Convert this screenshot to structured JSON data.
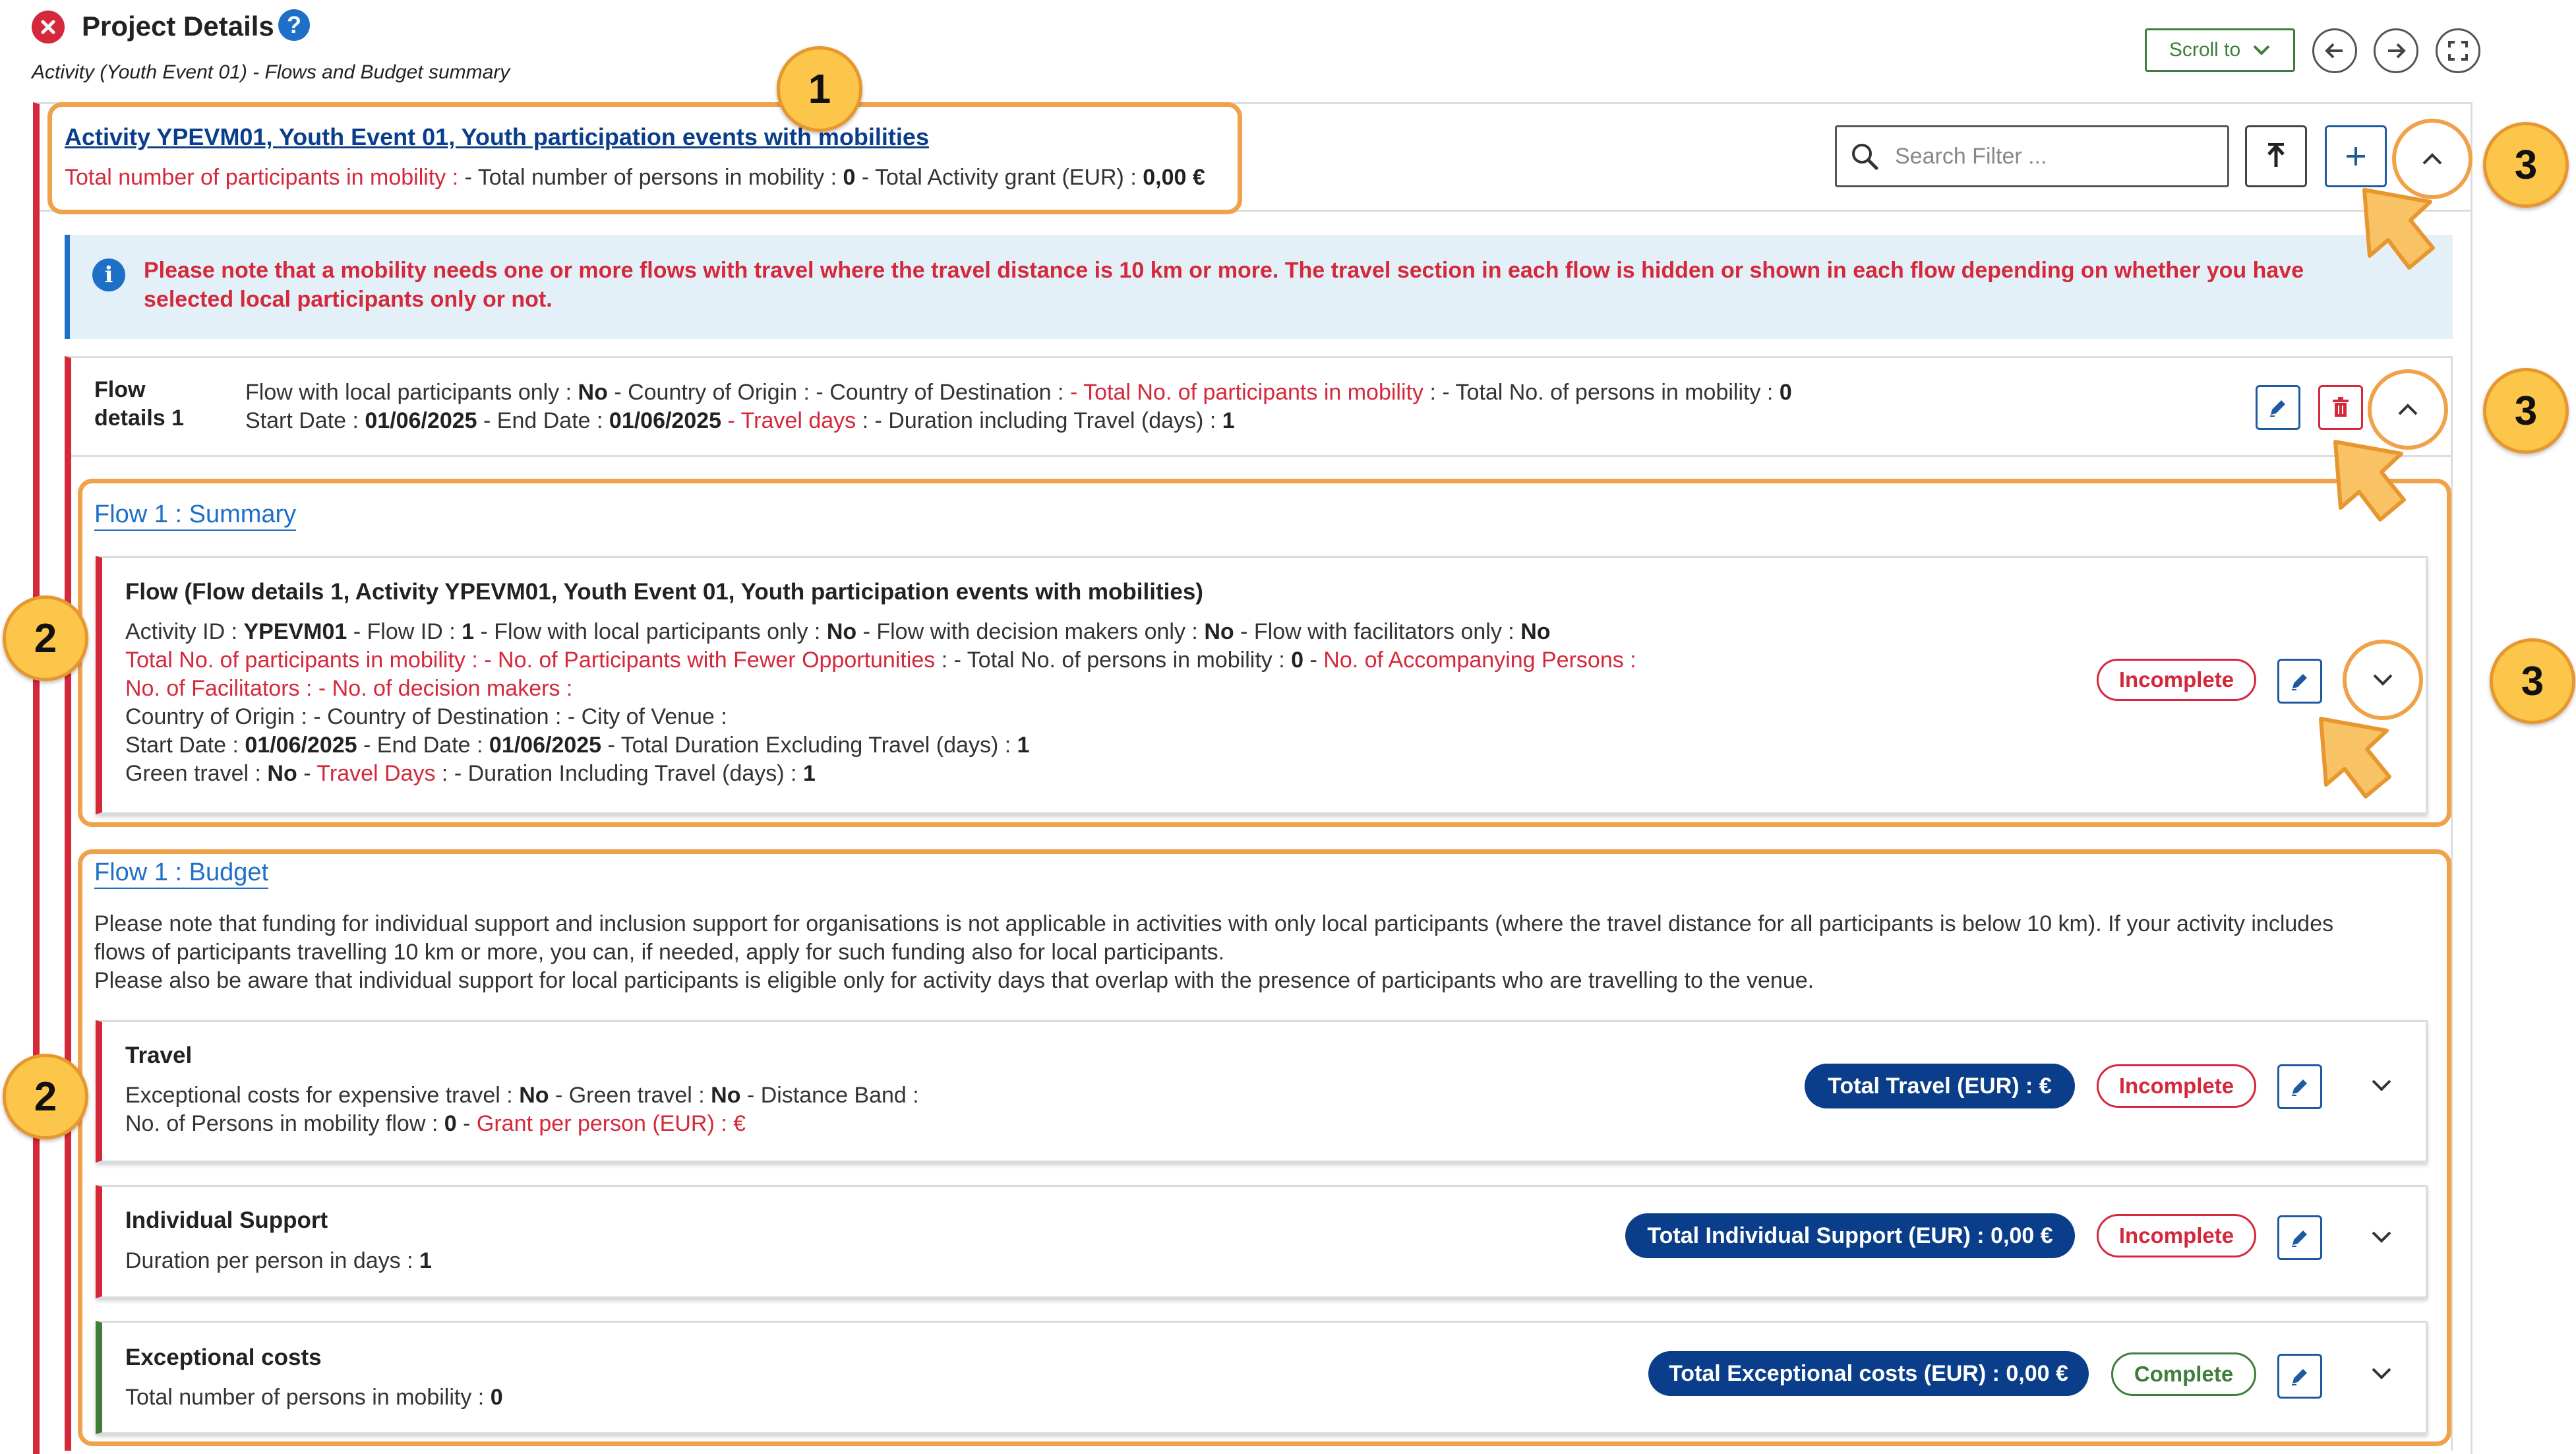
{
  "header": {
    "title": "Project Details",
    "subtitle": "Activity (Youth Event 01) - Flows and Budget summary",
    "scroll_label": "Scroll to"
  },
  "activity": {
    "link": "Activity YPEVM01, Youth Event 01, Youth participation events with mobilities",
    "summary_red": "Total number of participants in mobility :",
    "summary_rest_1": " - Total number of persons in mobility : ",
    "persons_value": "0",
    "summary_rest_2": " - Total Activity grant (EUR) : ",
    "grant_value": "0,00 €",
    "search_placeholder": "Search Filter ..."
  },
  "notice": {
    "line1": "Please note that a mobility needs one or more flows with travel where the travel distance is 10 km or more. The travel section in each flow is hidden or shown in each flow depending on whether you have",
    "line2": "selected local participants only or not."
  },
  "flow_details": {
    "title_line1": "Flow",
    "title_line2": "details 1",
    "l1_a": "Flow with local participants only : ",
    "l1_a_v": "No",
    "l1_b": " - Country of Origin :  - Country of Destination : ",
    "l1_c_red": " - Total No. of participants in mobility",
    "l1_d": "  :  - Total No. of persons in mobility  : ",
    "l1_d_v": "0",
    "l2_a": "Start Date : ",
    "l2_a_v": "01/06/2025",
    "l2_b": " - End Date : ",
    "l2_b_v": "01/06/2025",
    "l2_c_red": " - Travel days",
    "l2_d": " :  - Duration including Travel (days) : ",
    "l2_d_v": "1"
  },
  "flow_summary": {
    "section_title": "Flow 1 : Summary",
    "heading": "Flow (Flow details 1, Activity YPEVM01, Youth Event 01, Youth participation events with mobilities)",
    "r1_a": "Activity ID : ",
    "r1_a_v": "YPEVM01",
    "r1_b": " - Flow ID : ",
    "r1_b_v": "1",
    "r1_c": " - Flow with local participants only : ",
    "r1_c_v": "No",
    "r1_d": " - Flow with decision makers only : ",
    "r1_d_v": "No",
    "r1_e": " - Flow with facilitators only : ",
    "r1_e_v": "No",
    "r2_a_red": "Total No. of participants in mobility :",
    "r2_b_red": " - No. of Participants with Fewer Opportunities",
    "r2_c": " :  - Total No. of persons in mobility : ",
    "r2_c_v": "0",
    "r2_d": " - ",
    "r2_e_red": "No. of Accompanying Persons",
    "r2_f": " :",
    "r3_a_red": "No. of Facilitators :",
    "r3_b_red": "  - No. of decision makers :",
    "r4": "Country of Origin :  - Country of Destination :  - City of Venue :",
    "r5_a": "Start Date : ",
    "r5_a_v": "01/06/2025",
    "r5_b": " - End Date : ",
    "r5_b_v": "01/06/2025",
    "r5_c": " - Total Duration Excluding Travel (days) : ",
    "r5_c_v": "1",
    "r6_a": "Green travel : ",
    "r6_a_v": "No",
    "r6_b": " - ",
    "r6_c_red": "Travel Days",
    "r6_d": " :  - Duration Including Travel (days) : ",
    "r6_d_v": "1",
    "status": "Incomplete"
  },
  "flow_budget": {
    "section_title": "Flow 1 : Budget",
    "note1": "Please note that funding for individual support and inclusion support for organisations is not applicable in activities with only local participants (where the travel distance for all participants is below 10 km). If your activity includes",
    "note2": "flows of participants travelling 10 km or more, you can, if needed, apply for such funding also for local participants.",
    "note3": "Please also be aware that individual support for local participants is eligible only for activity days that overlap with the presence of participants who are travelling to the venue.",
    "travel": {
      "title": "Travel",
      "l1_a": "Exceptional costs for expensive travel : ",
      "l1_a_v": "No",
      "l1_b": " - Green travel : ",
      "l1_b_v": "No",
      "l1_c": " - Distance Band :",
      "l2_a": "No. of Persons in mobility flow : ",
      "l2_a_v": "0",
      "l2_b": " - ",
      "l2_c_red": "Grant per person (EUR) : €",
      "total": "Total Travel (EUR) : €",
      "status": "Incomplete"
    },
    "individual": {
      "title": "Individual Support",
      "l1_a": "Duration per person in days : ",
      "l1_a_v": "1",
      "total": "Total Individual Support (EUR) : 0,00 €",
      "status": "Incomplete"
    },
    "exceptional": {
      "title": "Exceptional costs",
      "l1_a": "Total number of persons in mobility : ",
      "l1_a_v": "0",
      "total": "Total Exceptional costs (EUR) : 0,00 €",
      "status": "Complete"
    }
  },
  "callouts": [
    "1",
    "2",
    "2",
    "3",
    "3",
    "3"
  ],
  "colors": {
    "accent_blue": "#1e5aa0",
    "link_blue": "#0b3e8a",
    "error_red": "#d4283b",
    "success_green": "#3e7d3b",
    "callout_orange": "#f0a24a",
    "callout_yellow": "#fbc64a",
    "notice_bg": "#e4f0f8"
  },
  "icons": [
    "close-icon",
    "help-icon",
    "chevron-down-icon",
    "arrow-left-icon",
    "arrow-right-icon",
    "fullscreen-icon",
    "search-icon",
    "upload-icon",
    "plus-icon",
    "chevron-up-icon",
    "info-icon",
    "pencil-icon",
    "trash-icon"
  ]
}
